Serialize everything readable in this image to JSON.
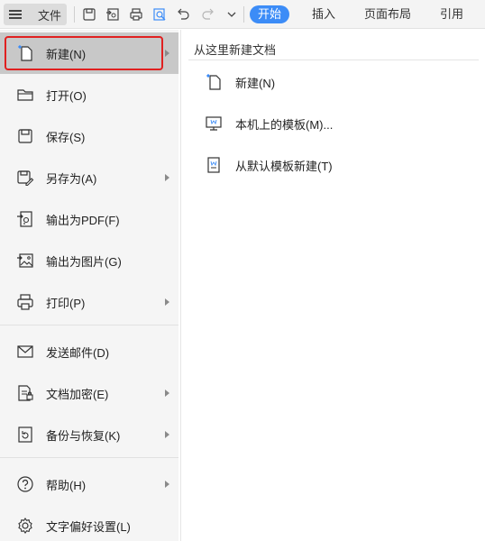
{
  "toolbar": {
    "file_label": "文件",
    "tabs": [
      {
        "label": "开始",
        "active": true
      },
      {
        "label": "插入"
      },
      {
        "label": "页面布局"
      },
      {
        "label": "引用"
      }
    ],
    "accent_color": "#3c8cf7"
  },
  "menu": {
    "items": [
      {
        "label": "新建(N)",
        "icon": "new-doc-icon",
        "submenu": true,
        "selected": true
      },
      {
        "label": "打开(O)",
        "icon": "folder-icon"
      },
      {
        "label": "保存(S)",
        "icon": "save-icon"
      },
      {
        "label": "另存为(A)",
        "icon": "save-as-icon",
        "submenu": true
      },
      {
        "label": "输出为PDF(F)",
        "icon": "export-pdf-icon"
      },
      {
        "label": "输出为图片(G)",
        "icon": "export-image-icon"
      },
      {
        "label": "打印(P)",
        "icon": "print-icon",
        "submenu": true
      },
      {
        "label": "发送邮件(D)",
        "icon": "mail-icon"
      },
      {
        "label": "文档加密(E)",
        "icon": "encrypt-icon",
        "submenu": true
      },
      {
        "label": "备份与恢复(K)",
        "icon": "backup-icon",
        "submenu": true
      },
      {
        "label": "帮助(H)",
        "icon": "help-icon",
        "submenu": true
      },
      {
        "label": "文字偏好设置(L)",
        "icon": "settings-icon"
      }
    ],
    "highlight_color": "#e02020"
  },
  "panel": {
    "title": "从这里新建文档",
    "items": [
      {
        "label": "新建(N)",
        "icon": "new-doc-icon"
      },
      {
        "label": "本机上的模板(M)...",
        "icon": "local-template-icon"
      },
      {
        "label": "从默认模板新建(T)",
        "icon": "default-template-icon"
      }
    ]
  }
}
